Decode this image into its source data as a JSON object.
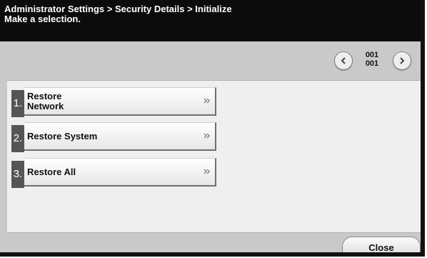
{
  "header": {
    "breadcrumb": "Administrator Settings > Security Details > Initialize",
    "instruction": "Make a selection."
  },
  "pager": {
    "current": "001",
    "total": "001",
    "prev_icon": "chevron-left-icon",
    "next_icon": "chevron-right-icon"
  },
  "menu": {
    "items": [
      {
        "number": "1.",
        "label_line1": "Restore",
        "label_line2": "Network",
        "icon": "double-chevron-right-icon"
      },
      {
        "number": "2.",
        "label": "Restore System",
        "icon": "double-chevron-right-icon"
      },
      {
        "number": "3.",
        "label": "Restore All",
        "icon": "double-chevron-right-icon"
      }
    ]
  },
  "footer": {
    "close_label": "Close"
  },
  "colors": {
    "header_bg": "#0c0c0c",
    "background": "#c9c9c9",
    "panel_bg": "#efefef",
    "number_tab_bg": "#555555"
  }
}
